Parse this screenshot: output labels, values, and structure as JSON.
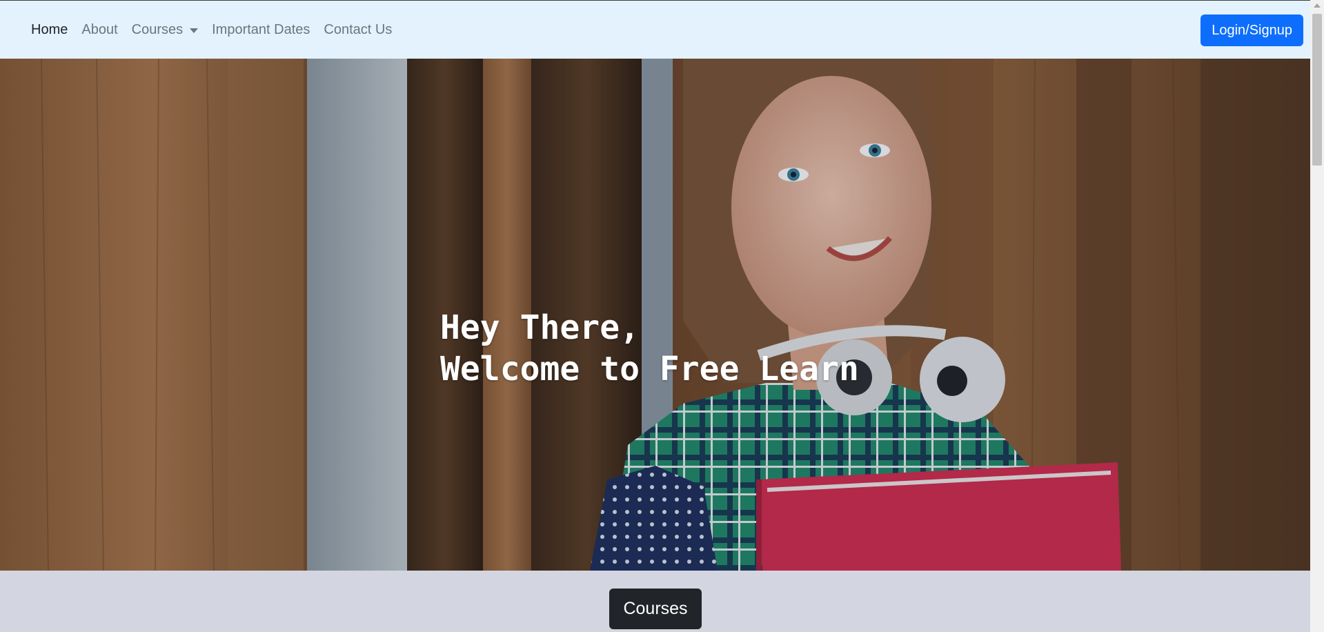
{
  "navbar": {
    "links": [
      {
        "label": "Home",
        "active": true
      },
      {
        "label": "About",
        "active": false
      },
      {
        "label": "Courses",
        "active": false,
        "dropdown": true
      },
      {
        "label": "Important Dates",
        "active": false
      },
      {
        "label": "Contact Us",
        "active": false
      }
    ],
    "login_label": "Login/Signup"
  },
  "hero": {
    "line1": "Hey There,",
    "line2": "Welcome to Free Learn"
  },
  "courses_section": {
    "button_label": "Courses"
  },
  "colors": {
    "navbar_bg": "#e3f2fd",
    "primary": "#0d6efd",
    "dark": "#212529",
    "section_bg": "#d3d6e0"
  }
}
